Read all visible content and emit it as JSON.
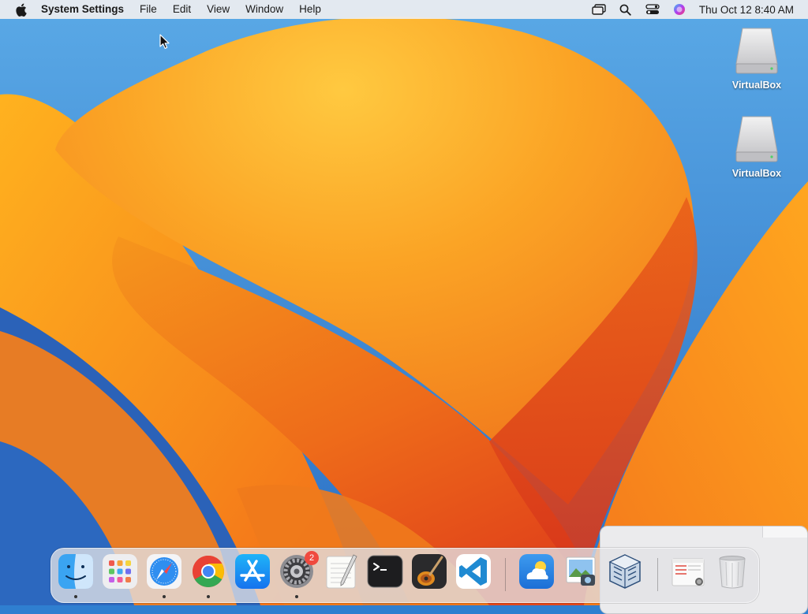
{
  "menubar": {
    "app_name": "System Settings",
    "menus": [
      "File",
      "Edit",
      "View",
      "Window",
      "Help"
    ],
    "status_icons": [
      "screen-mirroring-icon",
      "spotlight-search-icon",
      "control-center-icon",
      "siri-icon"
    ],
    "clock": "Thu Oct 12  8:40 AM"
  },
  "desktop": {
    "icons": [
      {
        "label": "VirtualBox",
        "icon": "drive-icon"
      },
      {
        "label": "VirtualBox",
        "icon": "drive-icon"
      }
    ]
  },
  "dock": {
    "items": [
      {
        "name": "Finder",
        "icon": "finder-icon",
        "running": true
      },
      {
        "name": "Launchpad",
        "icon": "launchpad-icon",
        "running": false
      },
      {
        "name": "Safari",
        "icon": "safari-icon",
        "running": true
      },
      {
        "name": "Google Chrome",
        "icon": "chrome-icon",
        "running": true
      },
      {
        "name": "App Store",
        "icon": "app-store-icon",
        "running": false
      },
      {
        "name": "System Settings",
        "icon": "system-settings-icon",
        "running": true,
        "badge": "2"
      },
      {
        "name": "TextEdit",
        "icon": "textedit-icon",
        "running": false
      },
      {
        "name": "Terminal",
        "icon": "terminal-icon",
        "running": false
      },
      {
        "name": "GarageBand",
        "icon": "garageband-icon",
        "running": false
      },
      {
        "name": "Visual Studio Code",
        "icon": "vscode-icon",
        "running": false
      },
      {
        "name": "Weather",
        "icon": "weather-icon",
        "running": false
      },
      {
        "name": "Preview",
        "icon": "preview-icon",
        "running": false
      },
      {
        "name": "VirtualBox",
        "icon": "virtualbox-icon",
        "running": false
      },
      {
        "name": "Downloads",
        "icon": "downloads-stack-icon",
        "running": false
      },
      {
        "name": "Trash",
        "icon": "trash-icon",
        "running": false
      }
    ]
  },
  "colors": {
    "accent_orange": "#f7961e",
    "wallpaper_blue": "#2f7fd0",
    "badge_red": "#f04a3e"
  }
}
